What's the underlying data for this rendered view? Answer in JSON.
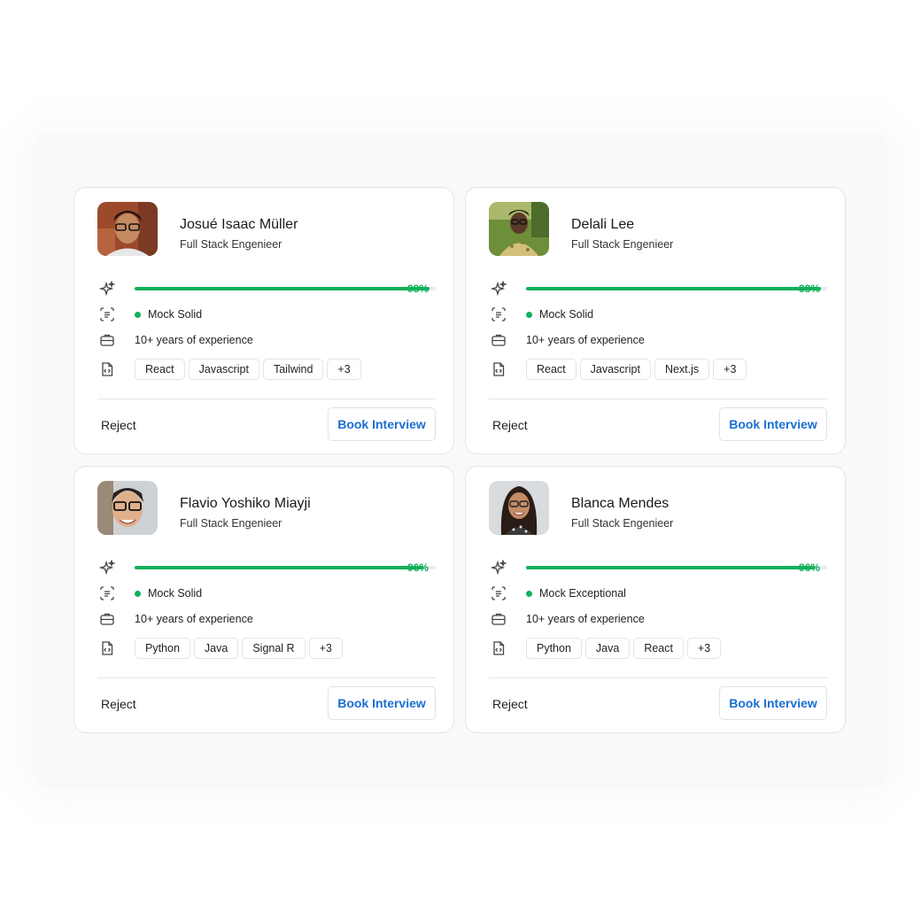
{
  "candidates": [
    {
      "name": "Josué Isaac Müller",
      "role": "Full Stack Engenieer",
      "score": 98,
      "score_label": "98%",
      "mock": "Mock Solid",
      "experience": "10+ years of experience",
      "tags": [
        "React",
        "Javascript",
        "Tailwind",
        "+3"
      ],
      "reject_label": "Reject",
      "book_label": "Book Interview"
    },
    {
      "name": "Delali Lee",
      "role": "Full Stack Engenieer",
      "score": 98,
      "score_label": "98%",
      "mock": "Mock Solid",
      "experience": "10+ years of experience",
      "tags": [
        "React",
        "Javascript",
        "Next.js",
        "+3"
      ],
      "reject_label": "Reject",
      "book_label": "Book Interview"
    },
    {
      "name": "Flavio Yoshiko Miayji",
      "role": "Full Stack Engenieer",
      "score": 96,
      "score_label": "96%",
      "mock": "Mock Solid",
      "experience": "10+ years of experience",
      "tags": [
        "Python",
        "Java",
        "Signal R",
        "+3"
      ],
      "reject_label": "Reject",
      "book_label": "Book Interview"
    },
    {
      "name": "Blanca Mendes",
      "role": "Full Stack Engenieer",
      "score": 96,
      "score_label": "96%",
      "mock": "Mock Exceptional",
      "experience": "10+ years of experience",
      "tags": [
        "Python",
        "Java",
        "React",
        "+3"
      ],
      "reject_label": "Reject",
      "book_label": "Book Interview"
    }
  ],
  "colors": {
    "accent_green": "#12b05a",
    "accent_blue": "#1a6fd1",
    "border": "#e2e5ea"
  },
  "icons": [
    "sparkle-icon",
    "document-scan-icon",
    "briefcase-icon",
    "code-file-icon"
  ]
}
